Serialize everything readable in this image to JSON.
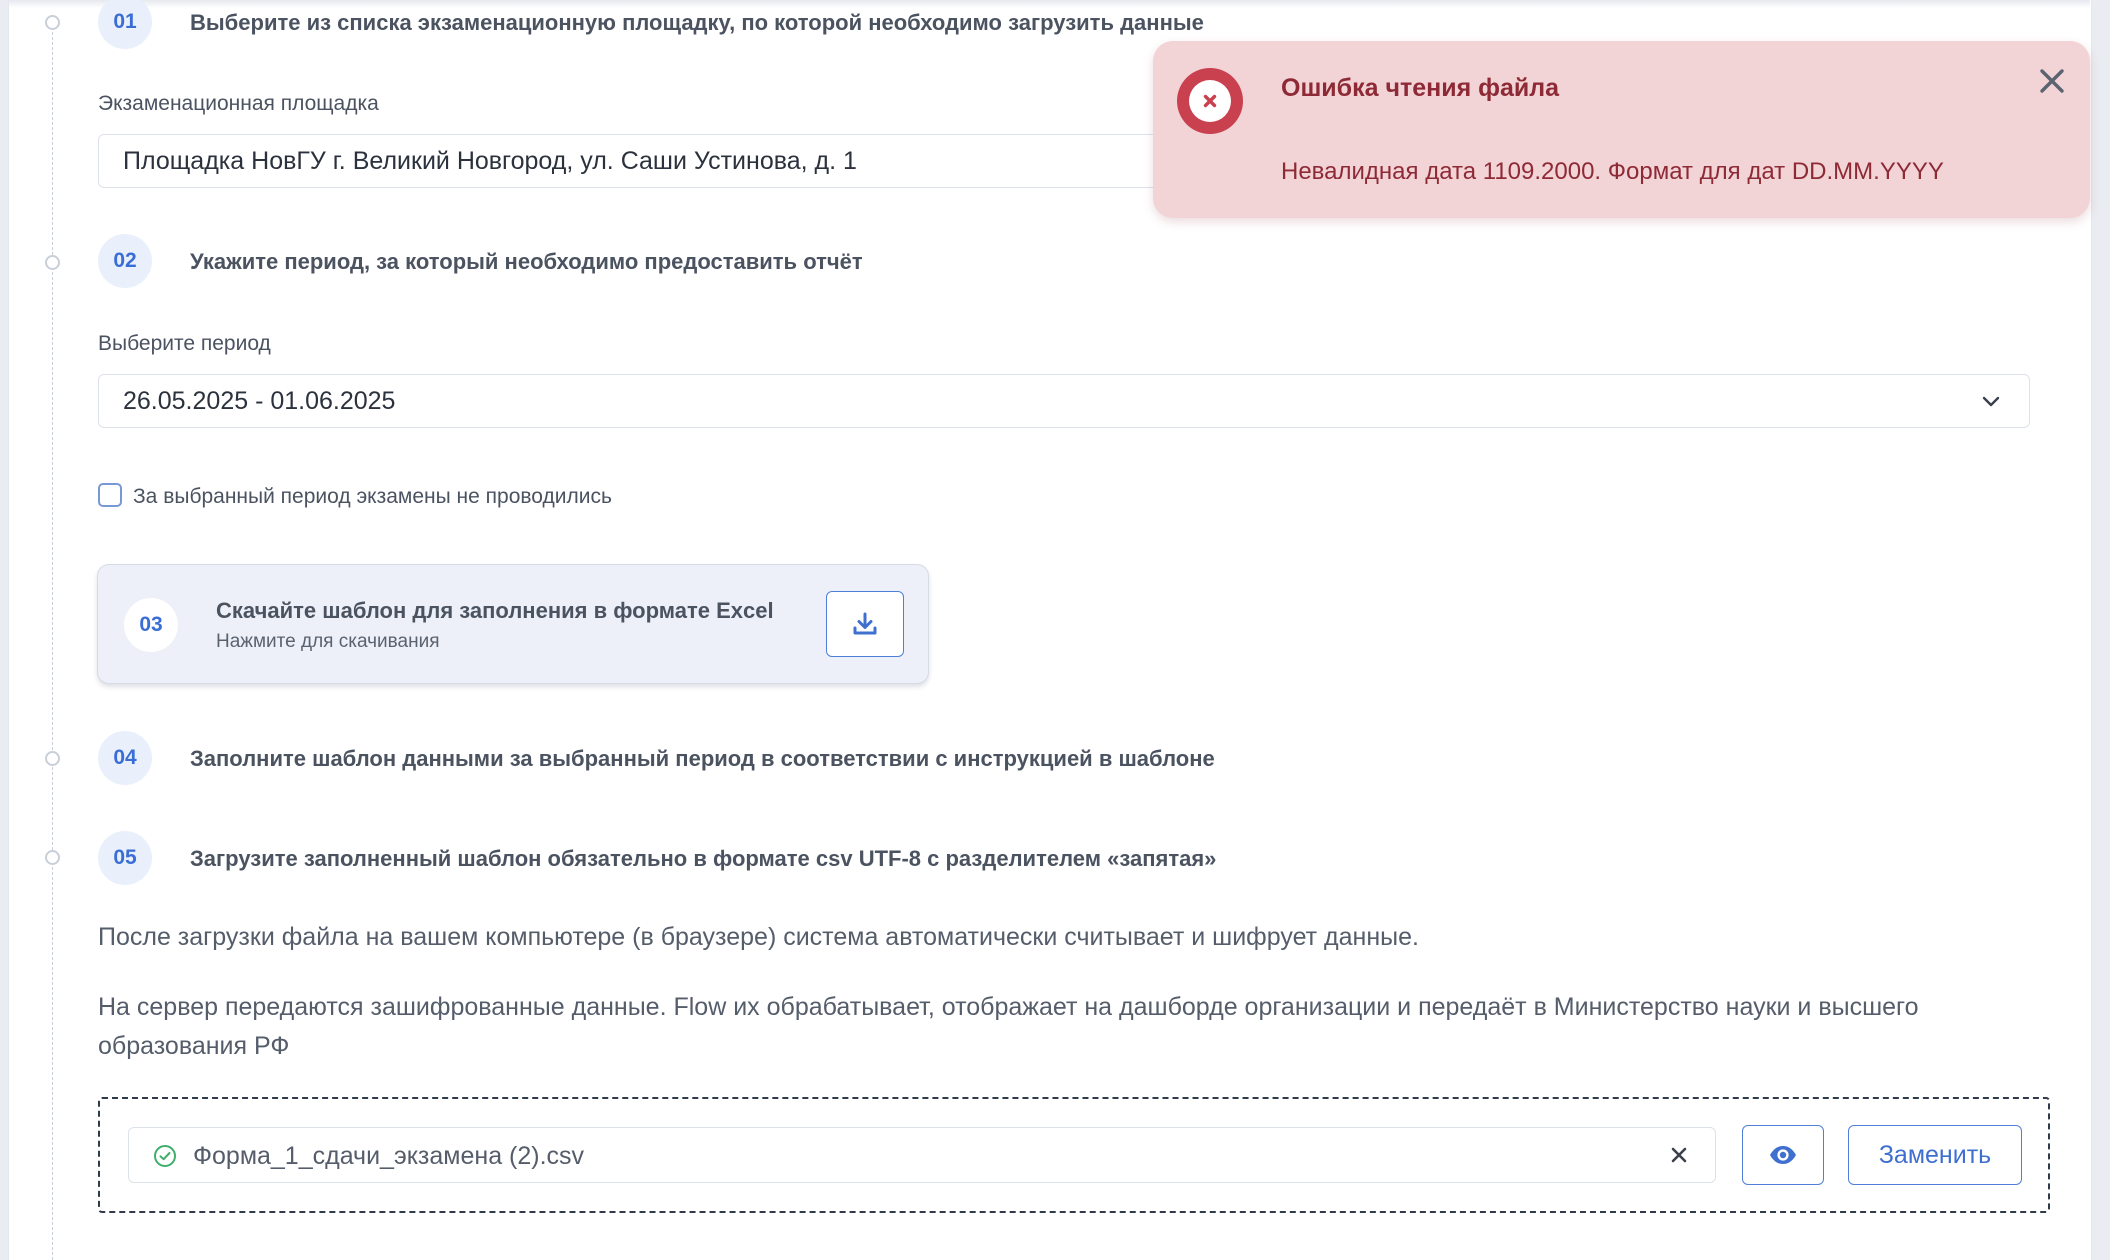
{
  "steps": [
    {
      "number": "01",
      "title": "Выберите из списка экзаменационную площадку, по которой необходимо загрузить данные"
    },
    {
      "number": "02",
      "title": "Укажите период, за который необходимо предоставить отчёт"
    },
    {
      "number": "03",
      "title": "Скачайте шаблон для заполнения в формате Excel",
      "subtitle": "Нажмите для скачивания"
    },
    {
      "number": "04",
      "title": "Заполните шаблон данными за выбранный период в соответствии с инструкцией в шаблоне"
    },
    {
      "number": "05",
      "title": "Загрузите заполненный шаблон обязательно в формате csv UTF-8 с разделителем «запятая»"
    }
  ],
  "venue": {
    "label": "Экзаменационная площадка",
    "value": "Площадка НовГУ г. Великий Новгород, ул. Саши Устинова, д. 1"
  },
  "period": {
    "label": "Выберите период",
    "value": "26.05.2025 - 01.06.2025"
  },
  "no_exams_checkbox": {
    "label": "За выбранный период экзамены не проводились",
    "checked": false
  },
  "upload_info": {
    "paragraph_1": "После загрузки файла на вашем компьютере (в браузере) система автоматически считывает и шифрует данные.",
    "paragraph_2": "На сервер передаются зашифрованные данные. Flow их обрабатывает, отображает на дашборде организации и передаёт в Министерство науки и высшего образования РФ"
  },
  "upload": {
    "file_name": "Форма_1_сдачи_экзамена (2).csv",
    "replace_label": "Заменить",
    "preview_icon": "eye-icon",
    "clear_icon": "close-icon",
    "status_icon": "check-circle-icon"
  },
  "toast": {
    "title": "Ошибка чтения файла",
    "message": "Невалидная дата 1109.2000. Формат для дат DD.MM.YYYY",
    "icon": "error-circle-icon",
    "close_icon": "close-icon"
  },
  "colors": {
    "accent": "#3f6fcf",
    "error_bg": "#f2d3d6",
    "error_text": "#8e2a36",
    "error_icon": "#c9404f",
    "success": "#3fae6a"
  }
}
